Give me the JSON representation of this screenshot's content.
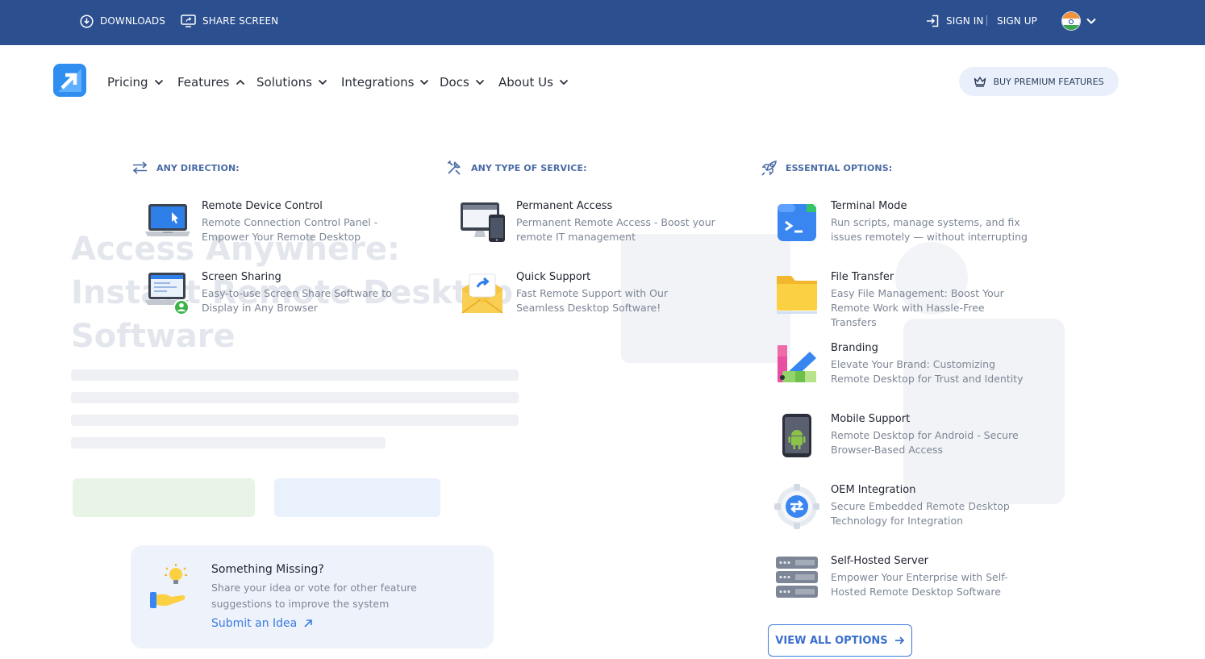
{
  "topbar": {
    "downloads": "DOWNLOADS",
    "share_screen": "SHARE SCREEN",
    "sign_in": "SIGN IN",
    "sign_up": "SIGN UP"
  },
  "nav": {
    "items": [
      "Pricing",
      "Features",
      "Solutions",
      "Integrations",
      "Docs",
      "About Us"
    ],
    "premium": "BUY PREMIUM FEATURES"
  },
  "hero": {
    "title": "Access Anywhere: Instant Remote Desktop Software"
  },
  "menu": {
    "columns": [
      {
        "title": "ANY DIRECTION:",
        "items": [
          {
            "title": "Remote Device Control",
            "desc": "Remote Connection Control Panel - Empower Your Remote Desktop",
            "icon": "laptop-cursor-icon"
          },
          {
            "title": "Screen Sharing",
            "desc": "Easy-to-use Screen Share Software to Display in Any Browser",
            "icon": "screen-share-icon"
          }
        ]
      },
      {
        "title": "ANY TYPE OF SERVICE:",
        "items": [
          {
            "title": "Permanent Access",
            "desc": "Permanent Remote Access - Boost your remote IT management",
            "icon": "monitor-phone-icon"
          },
          {
            "title": "Quick Support",
            "desc": "Fast Remote Support with Our Seamless Desktop Software!",
            "icon": "envelope-share-icon"
          }
        ]
      },
      {
        "title": "ESSENTIAL OPTIONS:",
        "items": [
          {
            "title": "Terminal Mode",
            "desc": "Run scripts, manage systems, and fix issues remotely — without interrupting",
            "icon": "terminal-icon"
          },
          {
            "title": "File Transfer",
            "desc": "Easy File Management: Boost Your Remote Work with Hassle-Free Transfers",
            "icon": "folder-icon"
          },
          {
            "title": "Branding",
            "desc": "Elevate Your Brand: Customizing Remote Desktop for Trust and Identity",
            "icon": "palette-icon"
          },
          {
            "title": "Mobile Support",
            "desc": "Remote Desktop for Android - Secure Browser-Based Access",
            "icon": "android-phone-icon"
          },
          {
            "title": "OEM Integration",
            "desc": "Secure Embedded Remote Desktop Technology for Integration",
            "icon": "gear-arrows-icon"
          },
          {
            "title": "Self-Hosted Server",
            "desc": "Empower Your Enterprise with Self-Hosted Remote Desktop Software",
            "icon": "server-icon"
          }
        ]
      }
    ],
    "missing": {
      "title": "Something Missing?",
      "desc": "Share your idea or vote for other feature suggestions to improve the system",
      "link": "Submit an Idea"
    },
    "view_all": "VIEW ALL OPTIONS"
  },
  "colors": {
    "topbar": "#2b4f8f",
    "accent": "#3a7ae0",
    "section_title": "#4a6aa6"
  }
}
